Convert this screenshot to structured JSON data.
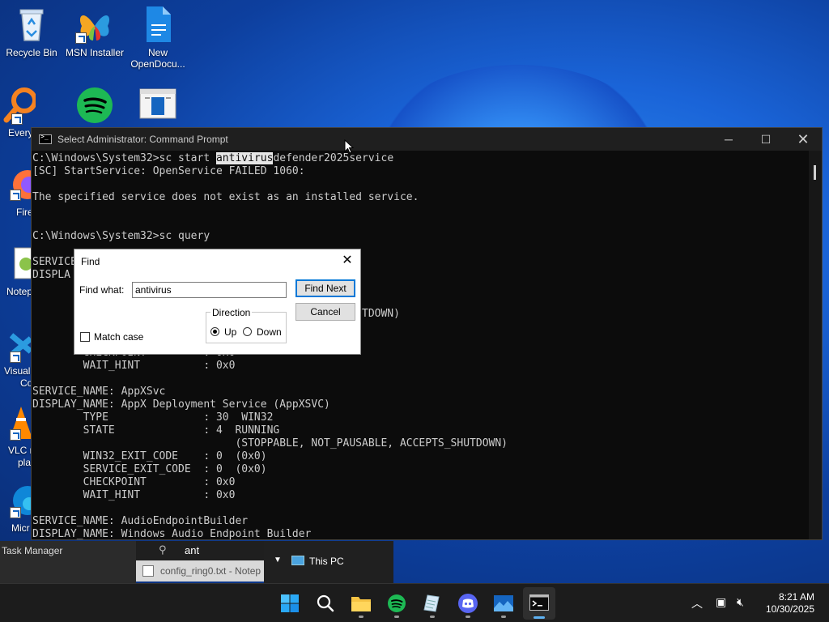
{
  "desktop": {
    "icons": [
      {
        "label": "Recycle Bin"
      },
      {
        "label": "MSN Installer"
      },
      {
        "label": "New OpenDocu..."
      },
      {
        "label": "Every"
      },
      {
        "label": "Fire"
      },
      {
        "label": "Notep"
      },
      {
        "label": "Visual"
      },
      {
        "label": "Co"
      },
      {
        "label": "VLC m"
      },
      {
        "label": "pla"
      },
      {
        "label": "Micr"
      }
    ]
  },
  "cmd": {
    "title": "Select Administrator: Command Prompt",
    "lines": {
      "l1_pre": "C:\\Windows\\System32>sc start ",
      "l1_hl": "antivirus",
      "l1_post": "defender2025service",
      "l2": "[SC] StartService: OpenService FAILED 1060:",
      "l3": "",
      "l4": "The specified service does not exist as an installed service.",
      "l5": "",
      "l6": "",
      "l7": "C:\\Windows\\System32>sc query",
      "l8": "",
      "l9": "SERVICE",
      "l10": "DISPLA",
      "l11": "",
      "l12": "",
      "l13": "                                  SABLE, IGNORES_SHUTDOWN)",
      "l14": "",
      "l15": "",
      "l16": "        CHECKPOINT         : 0x0",
      "l17": "        WAIT_HINT          : 0x0",
      "l18": "",
      "l19": "SERVICE_NAME: AppXSvc",
      "l20": "DISPLAY_NAME: AppX Deployment Service (AppXSVC)",
      "l21": "        TYPE               : 30  WIN32",
      "l22": "        STATE              : 4  RUNNING",
      "l23": "                                (STOPPABLE, NOT_PAUSABLE, ACCEPTS_SHUTDOWN)",
      "l24": "        WIN32_EXIT_CODE    : 0  (0x0)",
      "l25": "        SERVICE_EXIT_CODE  : 0  (0x0)",
      "l26": "        CHECKPOINT         : 0x0",
      "l27": "        WAIT_HINT          : 0x0",
      "l28": "",
      "l29": "SERVICE_NAME: AudioEndpointBuilder",
      "l30": "DISPLAY_NAME: Windows Audio Endpoint Builder"
    }
  },
  "find": {
    "title": "Find",
    "find_what_label": "Find what:",
    "find_what_value": "antivirus",
    "find_next": "Find Next",
    "cancel": "Cancel",
    "direction": "Direction",
    "up": "Up",
    "down": "Down",
    "match_case": "Match case"
  },
  "background": {
    "task_manager": "Task Manager",
    "search_text": "ant",
    "notepad_tab": "config_ring0.txt - Notep",
    "this_pc": "This PC"
  },
  "taskbar": {
    "time": "8:21 AM",
    "date": "10/30/2025"
  }
}
